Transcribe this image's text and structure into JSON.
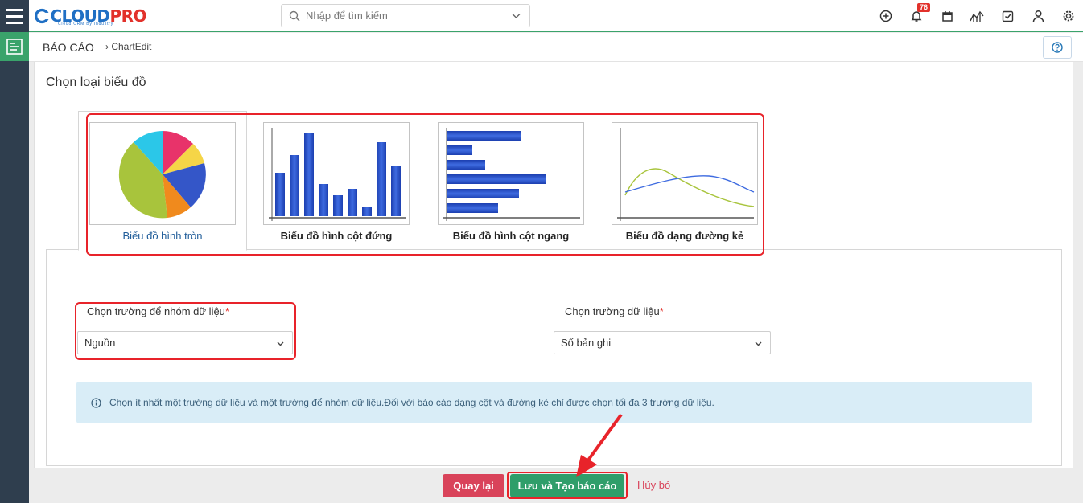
{
  "header": {
    "logo_left": "CLOUD",
    "logo_right": "PRO",
    "logo_tagline": "Cloud CRM By Industry",
    "search_placeholder": "Nhập để tìm kiếm",
    "notification_count": "76"
  },
  "breadcrumb": {
    "root": "BÁO CÁO",
    "child": "ChartEdit"
  },
  "main": {
    "section_title": "Chọn loại biểu đồ",
    "chart_types": [
      {
        "label": "Biểu đồ hình tròn",
        "selected": true
      },
      {
        "label": "Biểu đồ hình cột đứng",
        "selected": false
      },
      {
        "label": "Biểu đồ hình cột ngang",
        "selected": false
      },
      {
        "label": "Biểu đồ dạng đường kẻ",
        "selected": false
      }
    ],
    "group_field": {
      "label": "Chọn trường để nhóm dữ liệu",
      "required_mark": "*",
      "value": "Nguồn"
    },
    "data_field": {
      "label": "Chọn trường dữ liệu",
      "required_mark": "*",
      "value": "Số bản ghi"
    },
    "info_text": "Chọn ít nhất một trường dữ liệu và một trường để nhóm dữ liệu.Đối với báo cáo dạng cột và đường kẻ chỉ được chọn tối đa 3 trường dữ liệu."
  },
  "footer": {
    "back_label": "Quay lại",
    "save_label": "Lưu và Tạo báo cáo",
    "cancel_label": "Hủy bỏ"
  },
  "colors": {
    "accent_green": "#3aa36b",
    "sidebar": "#2f3e4e",
    "danger": "#d9435a",
    "highlight_red": "#e8232a"
  }
}
